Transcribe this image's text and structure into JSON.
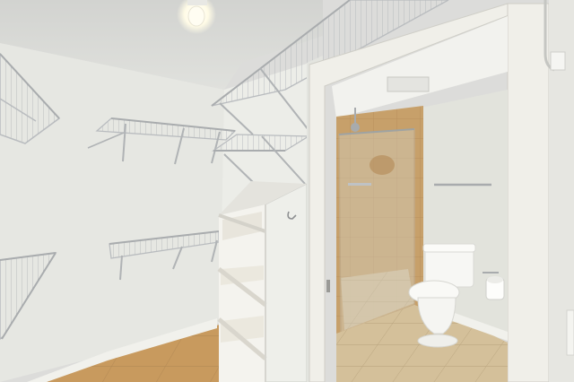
{
  "scene": {
    "colors": {
      "ceiling": "#d8d9d6",
      "left_wall": "#e6e7e2",
      "back_wall": "#ecede8",
      "partition": "#e9eae5",
      "floor_tile": "#c89a5e",
      "baseboard": "#f1f1ec",
      "shelf_wire": "#b9bcbf",
      "bath_wall": "#e2e3dc",
      "shower_tile": "#c7a06a",
      "glass": "#d8dcd8",
      "door_frame": "#f0efe9",
      "toilet": "#f7f7f4",
      "bath_floor": "#d4c09a",
      "light": "#fffdf2"
    }
  }
}
